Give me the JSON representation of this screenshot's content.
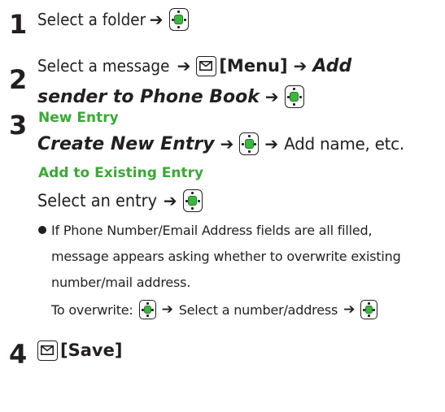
{
  "steps": [
    {
      "number": "1",
      "text": "Select a folder"
    },
    {
      "number": "2",
      "text": "Select a message",
      "menu_label": "[Menu]",
      "action_line1": "Add",
      "action_line2": "sender to Phone Book"
    },
    {
      "number": "3",
      "new_entry_heading": "New Entry",
      "create_action": "Create New Entry",
      "create_follow": "Add name, etc.",
      "existing_heading": "Add to Existing Entry",
      "existing_text": "Select an entry",
      "note_line1": "If Phone Number/Email Address fields are all filled,",
      "note_line2": "message appears asking whether to overwrite existing",
      "note_line3": "number/mail address.",
      "overwrite_prefix": "To overwrite:",
      "overwrite_middle": "Select a number/address"
    },
    {
      "number": "4",
      "save_label": "[Save]"
    }
  ],
  "glyphs": {
    "arrow": "➔"
  },
  "icons": {
    "center_key": "center-key-icon",
    "mail_key": "mail-key-icon"
  },
  "colors": {
    "heading_green": "#3aa935",
    "key_green": "#3fb541",
    "text": "#231f20"
  }
}
